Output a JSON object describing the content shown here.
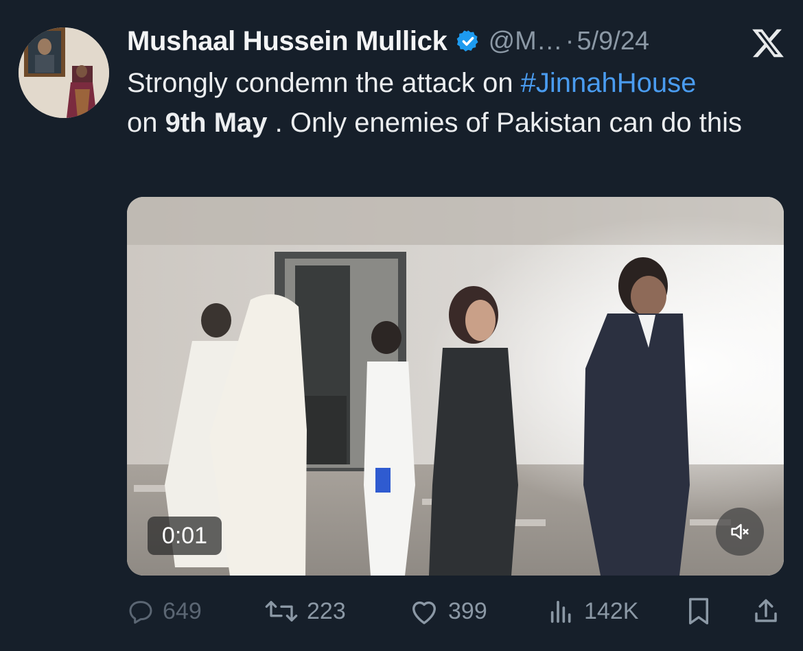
{
  "author": {
    "name": "Mushaal Hussein Mullick",
    "handle": "@M…",
    "separator": "·",
    "date": "5/9/24"
  },
  "tweet": {
    "text_part1": "Strongly condemn the attack on ",
    "hashtag": "#JinnahHouse",
    "text_part2": "on ",
    "bold": "9th May",
    "text_part3": " . Only enemies of Pakistan can do this"
  },
  "video": {
    "time": "0:01",
    "muted": true
  },
  "actions": {
    "replies": "649",
    "reposts": "223",
    "likes": "399",
    "views": "142K"
  },
  "colors": {
    "background": "#161f2a",
    "link": "#4a9cf0",
    "secondary": "#8b98a5",
    "verified": "#1d9bf0"
  },
  "icons": [
    "verified-badge-icon",
    "x-logo-icon",
    "mute-icon",
    "reply-icon",
    "repost-icon",
    "like-icon",
    "views-icon",
    "bookmark-icon",
    "share-icon"
  ]
}
